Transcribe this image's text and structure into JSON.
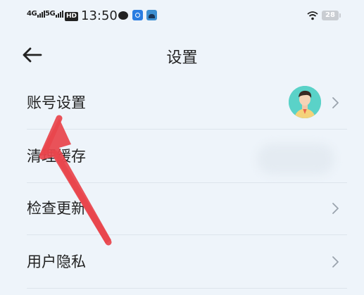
{
  "status_bar": {
    "net1": "4G",
    "net2": "5G",
    "hd": "HD",
    "time": "13:50",
    "battery": "28"
  },
  "header": {
    "title": "设置"
  },
  "settings": [
    {
      "label": "账号设置"
    },
    {
      "label": "清理缓存"
    },
    {
      "label": "检查更新"
    },
    {
      "label": "用户隐私"
    }
  ],
  "colors": {
    "background": "#eef4fa",
    "annotation_arrow": "#e8454c",
    "avatar_bg": "#5ad2c8"
  }
}
